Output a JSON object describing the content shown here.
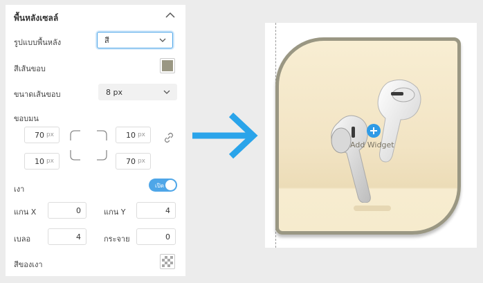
{
  "panel": {
    "section_title": "พื้นหลังเซลล์",
    "background_type": {
      "label": "รูปแบบพื้นหลัง",
      "value": "สี"
    },
    "border_color": {
      "label": "สีเส้นขอบ",
      "color": "#9a9783"
    },
    "border_width": {
      "label": "ขนาดเส้นขอบ",
      "value": "8 px"
    },
    "corner_radius": {
      "label": "ขอบมน",
      "unit": "px",
      "top_left": "70",
      "top_right": "10",
      "bottom_left": "10",
      "bottom_right": "70"
    },
    "shadow": {
      "label": "เงา",
      "toggle_label": "เปิด",
      "x_label": "แกน X",
      "x_value": "0",
      "y_label": "แกน Y",
      "y_value": "4",
      "blur_label": "เบลอ",
      "blur_value": "4",
      "spread_label": "กระจาย",
      "spread_value": "0",
      "color_label": "สีของเงา"
    }
  },
  "preview": {
    "add_widget_label": "Add Widget",
    "card_border_color": "#9a9783",
    "accent_color": "#2f9be6"
  },
  "arrow_color": "#2aa4ea"
}
